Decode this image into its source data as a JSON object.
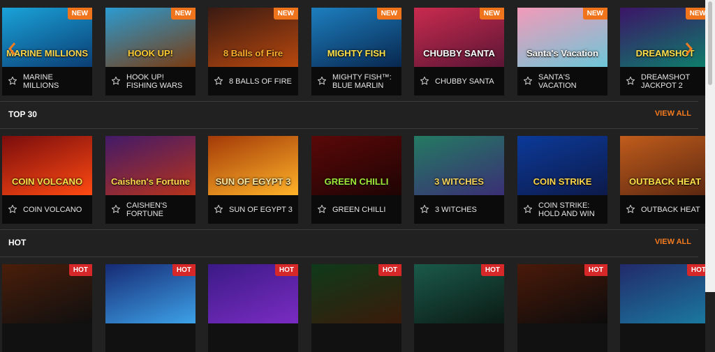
{
  "rows": {
    "new_games": {
      "badge_label": "NEW",
      "prev_icon": "chevron-left-icon",
      "next_icon": "chevron-right-icon",
      "games": [
        {
          "title": "MARINE MILLIONS",
          "logo": "MARINE MILLIONS",
          "c1": "#1aa3d9",
          "c2": "#0a3d73",
          "logocolor": "#ffd84d"
        },
        {
          "title": "HOOK UP! FISHING WARS",
          "logo": "HOOK UP!",
          "c1": "#2b9bd1",
          "c2": "#7a3b10",
          "logocolor": "#ffcc33"
        },
        {
          "title": "8 BALLS OF FIRE",
          "logo": "8 Balls of Fire",
          "c1": "#3a1a12",
          "c2": "#b8480e",
          "logocolor": "#ffb02e"
        },
        {
          "title": "MIGHTY FISH™: BLUE MARLIN",
          "logo": "MIGHTY FISH",
          "c1": "#1d7fbf",
          "c2": "#08274f",
          "logocolor": "#ffe14a"
        },
        {
          "title": "CHUBBY SANTA",
          "logo": "CHUBBY SANTA",
          "c1": "#c92b4e",
          "c2": "#5a1535",
          "logocolor": "#ffffff"
        },
        {
          "title": "SANTA'S VACATION",
          "logo": "Santa's Vacation",
          "c1": "#f39ab8",
          "c2": "#6dc6d8",
          "logocolor": "#ffffff"
        },
        {
          "title": "DREAMSHOT JACKPOT 2",
          "logo": "DREAMSHOT",
          "c1": "#3c1467",
          "c2": "#0d7f6b",
          "logocolor": "#ffe04d"
        }
      ]
    },
    "top30": {
      "heading": "TOP 30",
      "view_all": "VIEW ALL",
      "games": [
        {
          "title": "COIN VOLCANO",
          "logo": "COIN VOLCANO",
          "c1": "#7a0d0d",
          "c2": "#ff4a12",
          "logocolor": "#ffe14a"
        },
        {
          "title": "CAISHEN'S FORTUNE",
          "logo": "Caishen's Fortune",
          "c1": "#421a68",
          "c2": "#b7331c",
          "logocolor": "#ffd84d"
        },
        {
          "title": "SUN OF EGYPT 3",
          "logo": "SUN OF EGYPT 3",
          "c1": "#a33a08",
          "c2": "#ffb329",
          "logocolor": "#ffe9a3"
        },
        {
          "title": "GREEN CHILLI",
          "logo": "GREEN CHILLI",
          "c1": "#5a0808",
          "c2": "#1f0404",
          "logocolor": "#9fe83a"
        },
        {
          "title": "3 WITCHES",
          "logo": "3 WITCHES",
          "c1": "#247a62",
          "c2": "#3a2f75",
          "logocolor": "#f4d35e"
        },
        {
          "title": "COIN STRIKE: HOLD AND WIN",
          "logo": "COIN STRIKE",
          "c1": "#0b3a99",
          "c2": "#0d1a4a",
          "logocolor": "#ffd84d"
        },
        {
          "title": "OUTBACK HEAT",
          "logo": "OUTBACK HEAT",
          "c1": "#c05c1c",
          "c2": "#5a2710",
          "logocolor": "#ffe14a"
        }
      ]
    },
    "hot": {
      "heading": "HOT",
      "view_all": "VIEW ALL",
      "badge_label": "HOT",
      "games": [
        {
          "c1": "#4a1e0a",
          "c2": "#0f0f0f"
        },
        {
          "c1": "#162a74",
          "c2": "#3da2e8"
        },
        {
          "c1": "#3b1a86",
          "c2": "#7a2cc2"
        },
        {
          "c1": "#0f3a1a",
          "c2": "#3a1a0a"
        },
        {
          "c1": "#1a5a4a",
          "c2": "#0b1a14"
        },
        {
          "c1": "#4a1a0a",
          "c2": "#0b0b0b"
        },
        {
          "c1": "#222a6a",
          "c2": "#1a7aa0"
        }
      ]
    }
  },
  "star_icon": "star-outline-icon"
}
